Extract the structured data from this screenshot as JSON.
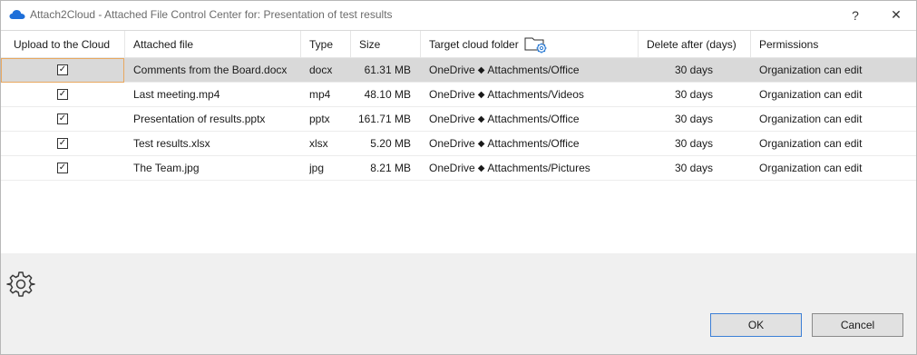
{
  "window": {
    "title": "Attach2Cloud - Attached File Control Center for: Presentation of test results",
    "help_label": "?",
    "close_label": "✕"
  },
  "columns": {
    "upload": "Upload to the Cloud",
    "file": "Attached file",
    "type": "Type",
    "size": "Size",
    "target": "Target cloud folder",
    "delete": "Delete after (days)",
    "permissions": "Permissions"
  },
  "rows": [
    {
      "checked": true,
      "file": "Comments from the Board.docx",
      "type": "docx",
      "size": "61.31 MB",
      "service": "OneDrive",
      "path": "Attachments/Office",
      "delete": "30 days",
      "permissions": "Organization can edit"
    },
    {
      "checked": true,
      "file": "Last meeting.mp4",
      "type": "mp4",
      "size": "48.10 MB",
      "service": "OneDrive",
      "path": "Attachments/Videos",
      "delete": "30 days",
      "permissions": "Organization can edit"
    },
    {
      "checked": true,
      "file": "Presentation of results.pptx",
      "type": "pptx",
      "size": "161.71 MB",
      "service": "OneDrive",
      "path": "Attachments/Office",
      "delete": "30 days",
      "permissions": "Organization can edit"
    },
    {
      "checked": true,
      "file": "Test results.xlsx",
      "type": "xlsx",
      "size": "5.20 MB",
      "service": "OneDrive",
      "path": "Attachments/Office",
      "delete": "30 days",
      "permissions": "Organization can edit"
    },
    {
      "checked": true,
      "file": "The Team.jpg",
      "type": "jpg",
      "size": "8.21 MB",
      "service": "OneDrive",
      "path": "Attachments/Pictures",
      "delete": "30 days",
      "permissions": "Organization can edit"
    }
  ],
  "separator_glyph": "◆",
  "check_glyph": "✓",
  "buttons": {
    "ok": "OK",
    "cancel": "Cancel"
  },
  "colors": {
    "selected_row": "#d9d9d9",
    "focus_border": "#e8a860",
    "cloud_icon": "#1e6fd9",
    "ok_border": "#3c7fd6"
  },
  "icons": {
    "app": "cloud-icon",
    "target_header": "folder-gear-icon",
    "settings": "gear-icon"
  }
}
